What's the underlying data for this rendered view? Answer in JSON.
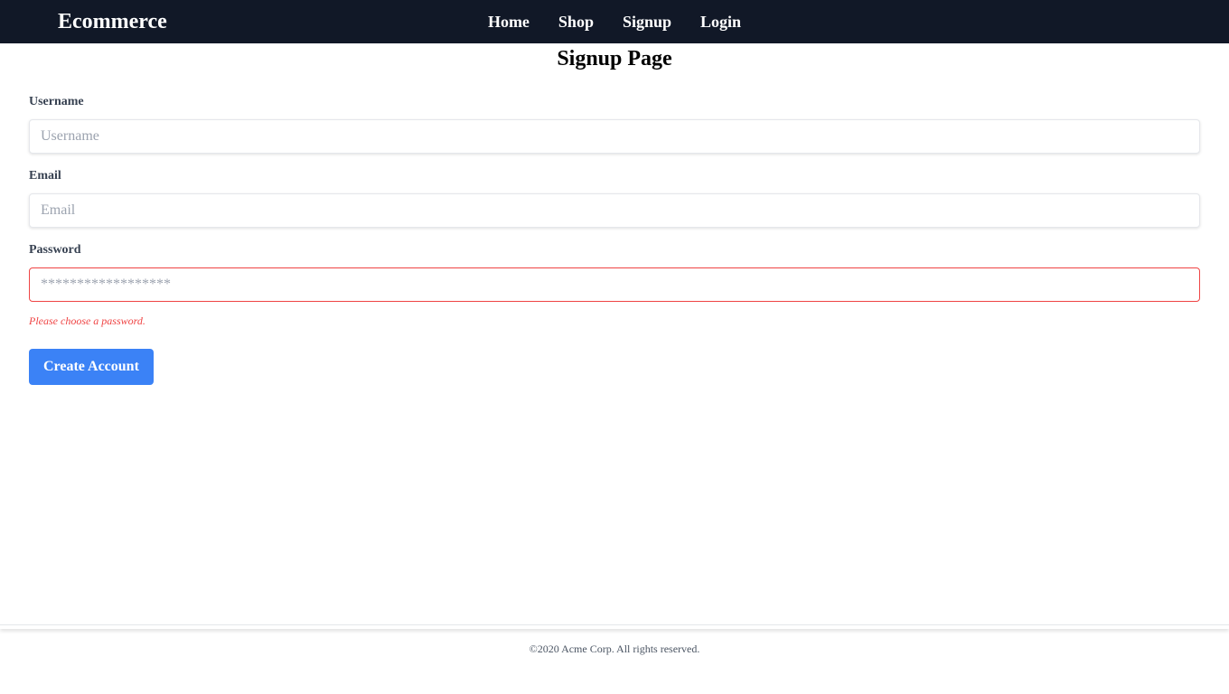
{
  "nav": {
    "brand": "Ecommerce",
    "links": [
      {
        "label": "Home"
      },
      {
        "label": "Shop"
      },
      {
        "label": "Signup"
      },
      {
        "label": "Login"
      }
    ]
  },
  "page": {
    "title": "Signup Page"
  },
  "form": {
    "username": {
      "label": "Username",
      "placeholder": "Username",
      "value": ""
    },
    "email": {
      "label": "Email",
      "placeholder": "Email",
      "value": ""
    },
    "password": {
      "label": "Password",
      "placeholder": "******************",
      "value": "",
      "error": "Please choose a password."
    },
    "submit_label": "Create Account"
  },
  "footer": {
    "text": "©2020 Acme Corp. All rights reserved."
  },
  "colors": {
    "navbar_bg": "#111827",
    "accent": "#3b82f6",
    "error": "#ef4444"
  }
}
